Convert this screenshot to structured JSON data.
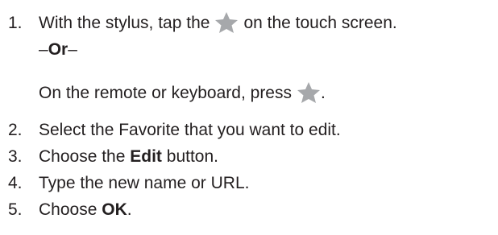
{
  "steps": [
    {
      "number": "1.",
      "before_icon": "With the stylus, tap the",
      "icon": "star-icon",
      "after_icon": "on the touch screen."
    },
    {
      "number": "2.",
      "text": "Select the Favorite that you want to edit."
    },
    {
      "number": "3.",
      "before_bold": "Choose the",
      "bold": "Edit",
      "after_bold": "button."
    },
    {
      "number": "4.",
      "text": "Type the new name or URL."
    },
    {
      "number": "5.",
      "before_bold": "Choose",
      "bold": "OK",
      "after_bold": "."
    }
  ],
  "or_separator": {
    "dash_left": "–",
    "word": "Or",
    "dash_right": "–"
  },
  "alternate": {
    "before_icon": "On the remote or keyboard, press",
    "icon": "star-icon",
    "after_icon": "."
  },
  "colors": {
    "text": "#231f20",
    "star": "#a6a8ab"
  }
}
